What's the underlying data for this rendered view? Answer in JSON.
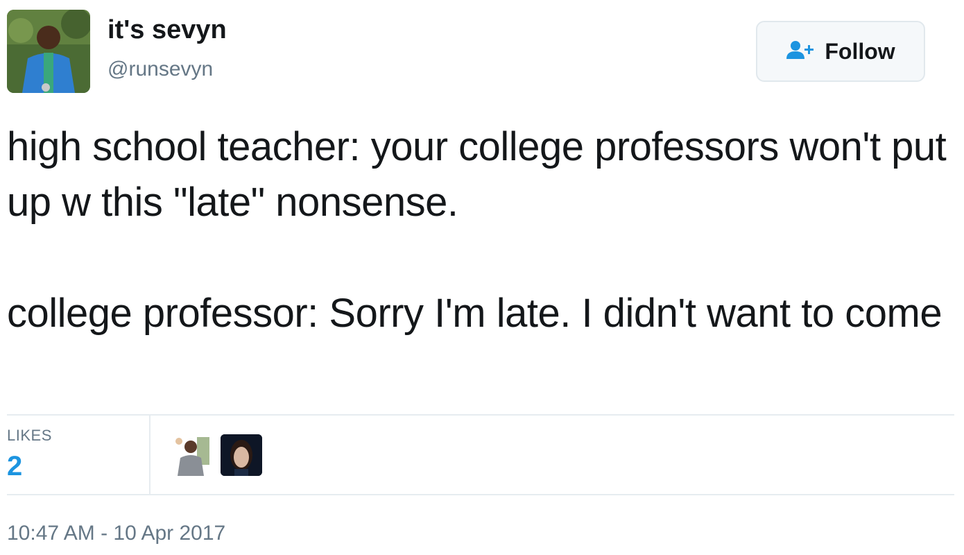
{
  "user": {
    "display_name": "it's sevyn",
    "handle": "@runsevyn"
  },
  "follow_button": {
    "label": "Follow",
    "icon": "follow-person-plus-icon"
  },
  "tweet": {
    "paragraph_1": "high school teacher: your college professors won't put up w this \"late\" nonsense.",
    "paragraph_2": "college professor: Sorry I'm late. I didn't want to come"
  },
  "stats": {
    "likes_label": "LIKES",
    "likes_count": "2"
  },
  "timestamp": "10:47 AM - 10 Apr 2017",
  "colors": {
    "accent": "#1c94e0",
    "text": "#14171a",
    "secondary_text": "#657786",
    "border": "#e6ecf0"
  }
}
